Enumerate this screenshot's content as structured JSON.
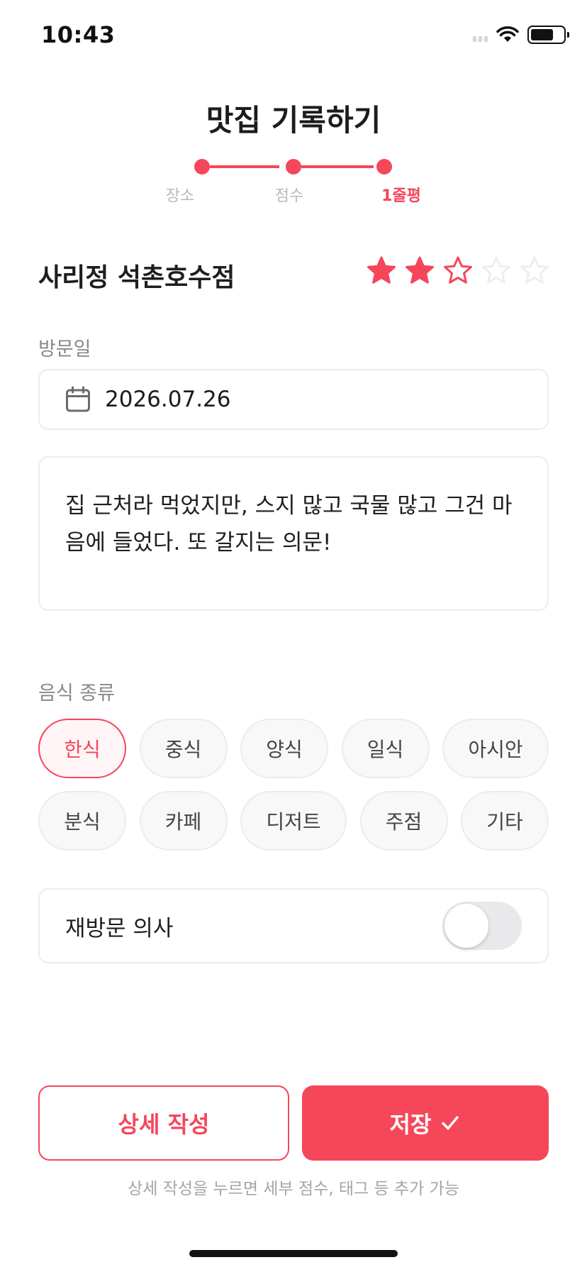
{
  "status_bar": {
    "time": "10:43",
    "wifi_icon": "wifi-icon",
    "battery_icon": "battery-icon",
    "battery_level": 0.7
  },
  "header": {
    "title": "맛집 기록하기"
  },
  "stepper": {
    "steps": [
      {
        "label": "장소",
        "active": false
      },
      {
        "label": "점수",
        "active": false
      },
      {
        "label": "1줄평",
        "active": true
      }
    ],
    "color": "#f5465a"
  },
  "place": {
    "name": "사리정 석촌호수점",
    "rating": 2.5,
    "max_rating": 5
  },
  "visit_date": {
    "label": "방문일",
    "value": "2026.07.26",
    "icon": "calendar-icon"
  },
  "review": {
    "text": "집 근처라 먹었지만, 스지 많고 국물 많고 그건 마음에 들었다. 또 갈지는 의문!"
  },
  "food_type": {
    "label": "음식 종류",
    "options_row1": [
      "한식",
      "중식",
      "양식",
      "일식",
      "아시안"
    ],
    "options_row2": [
      "분식",
      "카페",
      "디저트",
      "주점",
      "기타"
    ],
    "selected": "한식"
  },
  "revisit": {
    "label": "재방문 의사",
    "enabled": false
  },
  "buttons": {
    "detail_label": "상세 작성",
    "save_label": "저장",
    "save_icon": "checkmark-icon"
  },
  "hint": "상세 작성을 누르면 세부 점수, 태그 등 추가 가능",
  "colors": {
    "accent": "#f5465a",
    "border": "#ececec",
    "muted": "#888888"
  }
}
